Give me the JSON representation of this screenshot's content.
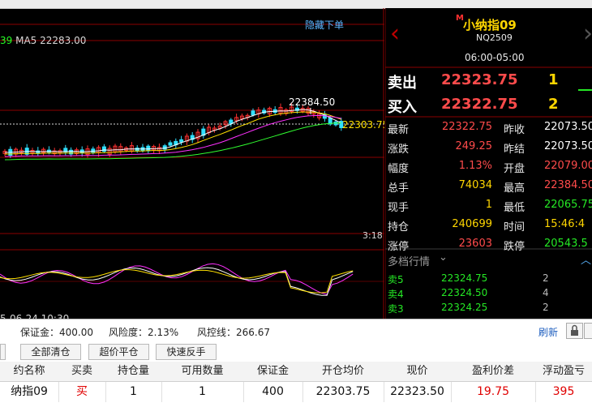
{
  "chart": {
    "hide_orders": "隐藏下单",
    "ma_prefix": "39",
    "ma_label": "MA5",
    "ma_value": "22283.00",
    "high_label": "22384.50",
    "current_label": "22303.75",
    "time_label": "3:18",
    "date_label": "5-06-24 10:30",
    "colors": {
      "up": "#ff3030",
      "down": "#30e0ff",
      "ma_white": "#ffffff",
      "ma_yellow": "#ffe000",
      "ma_magenta": "#ff30ff",
      "ma_green": "#30ff30",
      "grid": "#8b0000"
    }
  },
  "quote": {
    "market_badge": "M",
    "name": "小纳指09",
    "code": "NQ2509",
    "session": "06:00-05:00",
    "sell_label": "卖出",
    "sell_price": "22323.75",
    "sell_qty": "1",
    "buy_label": "买入",
    "buy_price": "22322.75",
    "buy_qty": "2",
    "stats_left": [
      {
        "label": "最新",
        "value": "22322.75",
        "color": "red"
      },
      {
        "label": "涨跌",
        "value": "249.25",
        "color": "red"
      },
      {
        "label": "幅度",
        "value": "1.13%",
        "color": "red"
      },
      {
        "label": "总手",
        "value": "74034",
        "color": "yellow"
      },
      {
        "label": "现手",
        "value": "1",
        "color": "yellow"
      },
      {
        "label": "持仓",
        "value": "240699",
        "color": "yellow"
      },
      {
        "label": "涨停",
        "value": "23603",
        "color": "red"
      }
    ],
    "stats_right": [
      {
        "label": "昨收",
        "value": "22073.50",
        "color": "white"
      },
      {
        "label": "昨结",
        "value": "22073.50",
        "color": "white"
      },
      {
        "label": "开盘",
        "value": "22079.00",
        "color": "red"
      },
      {
        "label": "最高",
        "value": "22384.50",
        "color": "red"
      },
      {
        "label": "最低",
        "value": "22065.75",
        "color": "green"
      },
      {
        "label": "时间",
        "value": "15:46:4",
        "color": "yellow"
      },
      {
        "label": "跌停",
        "value": "20543.5",
        "color": "green"
      }
    ],
    "depth_title": "多档行情",
    "depth": [
      {
        "label": "卖5",
        "price": "22324.75",
        "qty": "2"
      },
      {
        "label": "卖4",
        "price": "22324.50",
        "qty": "4"
      },
      {
        "label": "卖3",
        "price": "22324.25",
        "qty": "2"
      }
    ]
  },
  "account": {
    "margin": "保证金：400.00",
    "risk": "风险度：2.13%",
    "risk_line": "风控线：266.67",
    "refresh": "刷新"
  },
  "toolbar": {
    "close_all": "全部清仓",
    "close_flat": "超价平仓",
    "reverse": "快速反手"
  },
  "table": {
    "headers": [
      "约名称",
      "买卖",
      "持仓量",
      "可用数量",
      "保证金",
      "开仓均价",
      "现价",
      "盈利价差",
      "浮动盈亏"
    ],
    "row": [
      "纳指09",
      "买",
      "1",
      "1",
      "400",
      "22303.75",
      "22323.50",
      "19.75",
      "395"
    ]
  }
}
